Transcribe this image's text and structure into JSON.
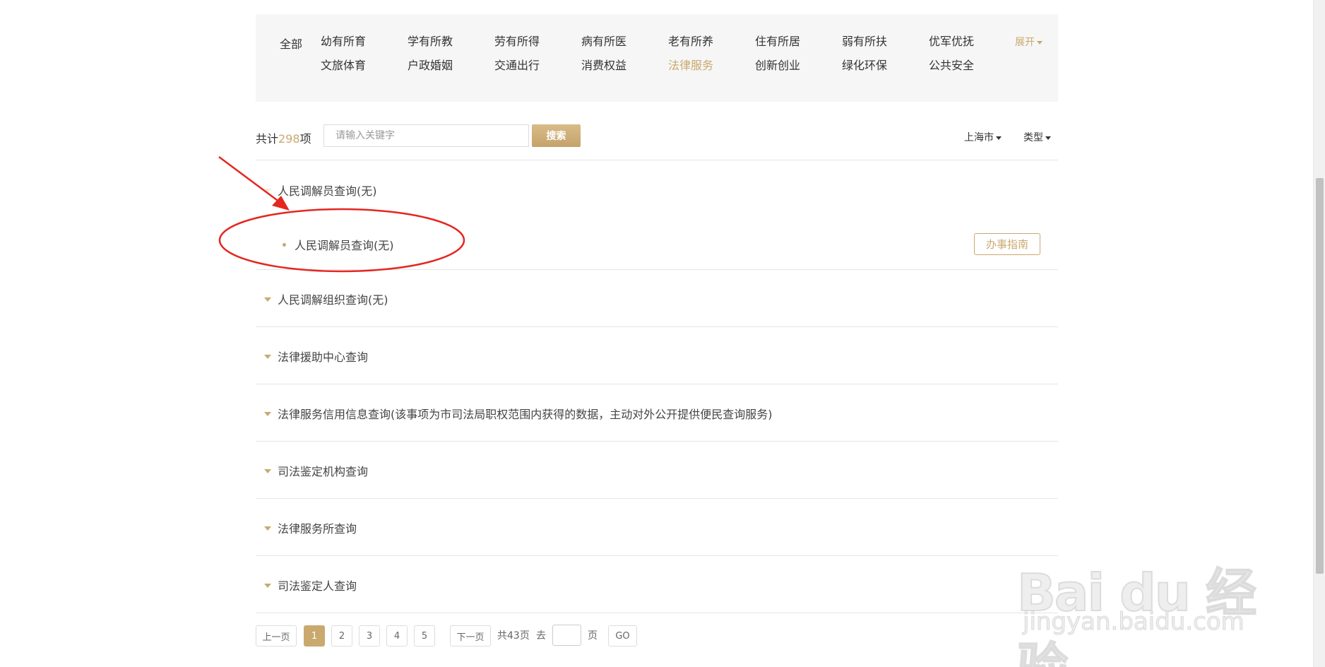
{
  "categories": {
    "all_label": "全部",
    "items": [
      {
        "label": "幼有所育"
      },
      {
        "label": "学有所教"
      },
      {
        "label": "劳有所得"
      },
      {
        "label": "病有所医"
      },
      {
        "label": "老有所养"
      },
      {
        "label": "住有所居"
      },
      {
        "label": "弱有所扶"
      },
      {
        "label": "优军优抚"
      },
      {
        "label": "文旅体育"
      },
      {
        "label": "户政婚姻"
      },
      {
        "label": "交通出行"
      },
      {
        "label": "消费权益"
      },
      {
        "label": "法律服务"
      },
      {
        "label": "创新创业"
      },
      {
        "label": "绿化环保"
      },
      {
        "label": "公共安全"
      }
    ],
    "active": "法律服务",
    "expand_label": "展开"
  },
  "search": {
    "total_prefix": "共计",
    "total_count": "298",
    "total_suffix": "项",
    "placeholder": "请输入关键字",
    "button_label": "搜索",
    "city_label": "上海市",
    "type_label": "类型"
  },
  "list": {
    "expanded_title": "人民调解员查询(无)",
    "sub_item": "人民调解员查询(无)",
    "guide_label": "办事指南",
    "groups": [
      "人民调解组织查询(无)",
      "法律援助中心查询",
      "法律服务信用信息查询(该事项为市司法局职权范围内获得的数据，主动对外公开提供便民查询服务)",
      "司法鉴定机构查询",
      "法律服务所查询",
      "司法鉴定人查询"
    ]
  },
  "pagination": {
    "prev_label": "上一页",
    "pages": [
      "1",
      "2",
      "3",
      "4",
      "5"
    ],
    "current": "1",
    "next_label": "下一页",
    "total_pages_text": "共43页",
    "goto_label": "去",
    "page_unit": "页",
    "go_label": "GO"
  },
  "watermark": {
    "logo": "Bai du 经验",
    "url": "jingyan.baidu.com"
  },
  "colors": {
    "accent": "#c9a96e",
    "annotation_red": "#e5261f",
    "panel_bg": "#f6f6f6"
  }
}
